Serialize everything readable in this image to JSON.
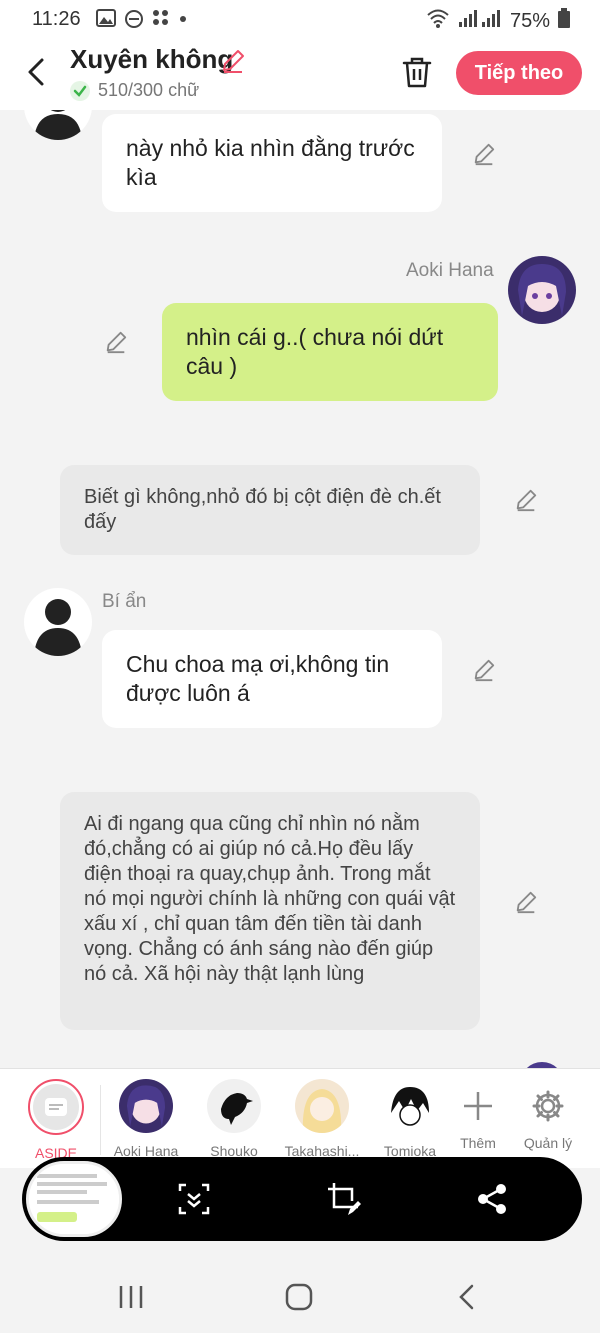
{
  "status_bar": {
    "time": "11:26",
    "battery": "75%"
  },
  "header": {
    "title": "Xuyên không",
    "word_count": "510/300 chữ",
    "next_button": "Tiếp theo"
  },
  "messages": [
    {
      "type": "left",
      "text": "này nhỏ kia nhìn đằng trước kìa"
    },
    {
      "type": "me",
      "sender": "Aoki Hana",
      "text": "nhìn cái g..( chưa nói dứt câu )"
    },
    {
      "type": "aside",
      "text": "Biết gì không,nhỏ đó bị cột điện đè ch.ết đấy"
    },
    {
      "type": "left",
      "sender": "Bí ẩn",
      "text": "Chu choa mạ ơi,không tin được luôn á"
    },
    {
      "type": "aside",
      "text": "Ai đi ngang qua cũng chỉ nhìn nó nằm đó,chẳng có ai giúp nó cả.Họ đều lấy điện thoại ra quay,chụp ảnh. Trong mắt nó mọi người chính là những con quái vật xấu xí , chỉ quan tâm đến tiền tài danh vọng. Chẳng có ánh sáng nào đến giúp nó cả. Xã hội này thật lạnh lùng"
    }
  ],
  "characters": [
    {
      "label": "ASIDE",
      "active": true
    },
    {
      "label": "Aoki Hana"
    },
    {
      "label": "Shouko"
    },
    {
      "label": "Takahashi..."
    },
    {
      "label": "Tomioka"
    },
    {
      "label": "Thêm"
    },
    {
      "label": "Quản lý"
    }
  ],
  "colors": {
    "accent": "#f04f6a",
    "my_bubble": "#d4f089",
    "aside_bubble": "#e9e9e9"
  }
}
